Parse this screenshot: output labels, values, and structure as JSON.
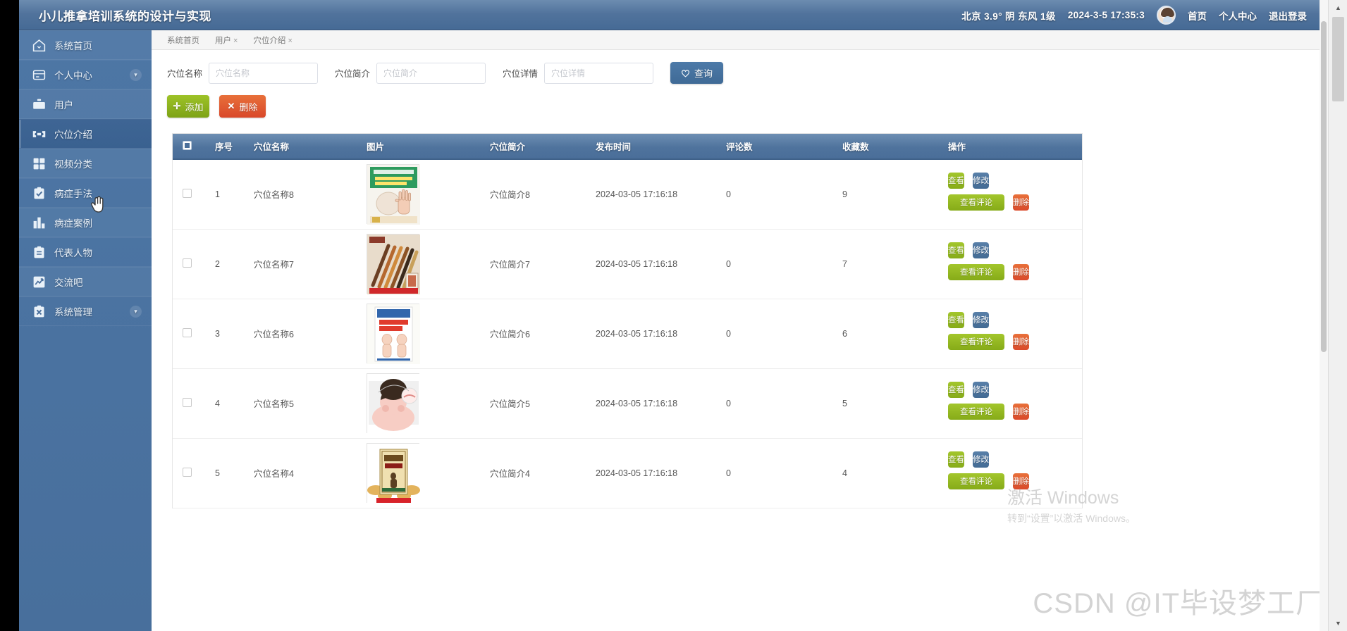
{
  "header": {
    "brand": "小儿推拿培训系统的设计与实现",
    "weather": "北京 3.9° 阴 东风 1级",
    "datetime": "2024-3-5 17:35:3",
    "links": [
      {
        "label": "首页",
        "name": "home"
      },
      {
        "label": "个人中心",
        "name": "profile"
      },
      {
        "label": "退出登录",
        "name": "logout"
      }
    ]
  },
  "sidebar": {
    "items": [
      {
        "label": "系统首页",
        "icon": "home-icon",
        "caret": false,
        "active": false
      },
      {
        "label": "个人中心",
        "icon": "card-icon",
        "caret": true,
        "active": false
      },
      {
        "label": "用户",
        "icon": "briefcase-icon",
        "caret": false,
        "active": false
      },
      {
        "label": "穴位介绍",
        "icon": "acupoint-icon",
        "caret": false,
        "active": true
      },
      {
        "label": "视频分类",
        "icon": "grid-icon",
        "caret": false,
        "active": false
      },
      {
        "label": "病症手法",
        "icon": "clipboard-check-icon",
        "caret": false,
        "active": false
      },
      {
        "label": "病症案例",
        "icon": "bar-chart-icon",
        "caret": false,
        "active": false
      },
      {
        "label": "代表人物",
        "icon": "clipboard-icon",
        "caret": false,
        "active": false
      },
      {
        "label": "交流吧",
        "icon": "trend-icon",
        "caret": false,
        "active": false
      },
      {
        "label": "系统管理",
        "icon": "clipboard-x-icon",
        "caret": true,
        "active": false
      }
    ]
  },
  "tabs": [
    {
      "label": "系统首页",
      "closable": false
    },
    {
      "label": "用户",
      "closable": true
    },
    {
      "label": "穴位介绍",
      "closable": true
    }
  ],
  "search": {
    "fields": [
      {
        "label": "穴位名称",
        "placeholder": "穴位名称",
        "value": ""
      },
      {
        "label": "穴位简介",
        "placeholder": "穴位简介",
        "value": ""
      },
      {
        "label": "穴位详情",
        "placeholder": "穴位详情",
        "value": ""
      }
    ],
    "query_label": "查询",
    "query_icon": "heart-icon"
  },
  "toolbar": {
    "add_label": "添加",
    "add_icon": "plus-icon",
    "delete_label": "删除",
    "delete_icon": "close-icon"
  },
  "table": {
    "columns": [
      "序号",
      "穴位名称",
      "图片",
      "穴位简介",
      "发布时间",
      "评论数",
      "收藏数",
      "操作"
    ],
    "ops": {
      "view": "查看",
      "edit": "修改",
      "comments": "查看评论",
      "delete": "删除"
    },
    "rows": [
      {
        "index": "1",
        "name": "穴位名称8",
        "intro": "穴位简介8",
        "time": "2024-03-05 17:16:18",
        "comments": "0",
        "favorites": "9",
        "thumb": "hand-reflex-chart"
      },
      {
        "index": "2",
        "name": "穴位名称7",
        "intro": "穴位简介7",
        "time": "2024-03-05 17:16:18",
        "comments": "0",
        "favorites": "7",
        "thumb": "wooden-massage-sticks"
      },
      {
        "index": "3",
        "name": "穴位名称6",
        "intro": "穴位简介6",
        "time": "2024-03-05 17:16:18",
        "comments": "0",
        "favorites": "6",
        "thumb": "meridian-manual-book"
      },
      {
        "index": "4",
        "name": "穴位名称5",
        "intro": "穴位简介5",
        "time": "2024-03-05 17:16:18",
        "comments": "0",
        "favorites": "5",
        "thumb": "baby-massage-illustration"
      },
      {
        "index": "5",
        "name": "穴位名称4",
        "intro": "穴位简介4",
        "time": "2024-03-05 17:16:18",
        "comments": "0",
        "favorites": "4",
        "thumb": "ginger-plaster-box"
      }
    ]
  },
  "watermarks": {
    "windows_line1": "激活 Windows",
    "windows_line2": "转到“设置”以激活 Windows。",
    "csdn": "CSDN @IT毕设梦工厂"
  },
  "colors": {
    "header_blue": "#4f739d",
    "sidebar_blue": "#4a6f9c",
    "green": "#8eb420",
    "red": "#de5130",
    "blue": "#49709b"
  }
}
